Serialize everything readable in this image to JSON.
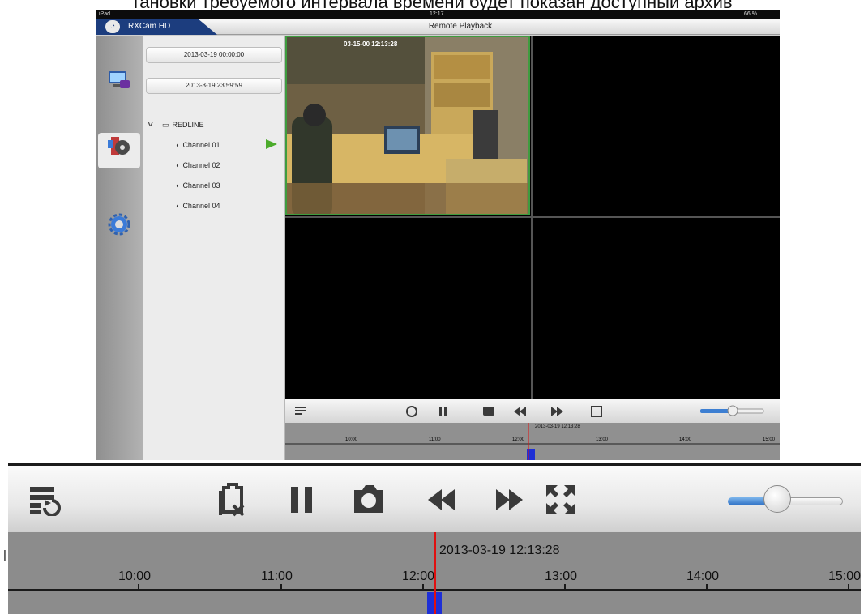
{
  "caption": "тановки требуемого интервала времени будет показан доступный архив",
  "ipad": {
    "status": {
      "device": "iPad",
      "time": "12:17",
      "battery": "66 %"
    },
    "app_name": "RXCam HD",
    "screen_title": "Remote Playback",
    "date_from": "2013-03-19 00:00:00",
    "date_to": "2013-3-19 23:59:59",
    "device_name": "REDLINE",
    "channels": [
      "Channel 01",
      "Channel 02",
      "Channel 03",
      "Channel 04"
    ],
    "video_osd": "03-15-00 12:13:28",
    "mini_timeline": {
      "cursor_label": "2013-03-19 12:13:28",
      "ticks": [
        "10:00",
        "11:00",
        "12:00",
        "13:00",
        "14:00",
        "15:00"
      ]
    }
  },
  "toolbar": {
    "icons": [
      "record-list-icon",
      "clip-cut-icon",
      "pause-icon",
      "snapshot-icon",
      "rewind-icon",
      "fast-forward-icon",
      "fullscreen-icon"
    ],
    "volume_level": 0.35
  },
  "timeline": {
    "cursor_label": "2013-03-19 12:13:28",
    "ticks": [
      "10:00",
      "11:00",
      "12:00",
      "13:00",
      "14:00",
      "15:00"
    ],
    "first_partial_tick": "|",
    "colors": {
      "cursor": "#e01010",
      "record": "#1e2fd6",
      "background": "#8c8c8c"
    }
  }
}
